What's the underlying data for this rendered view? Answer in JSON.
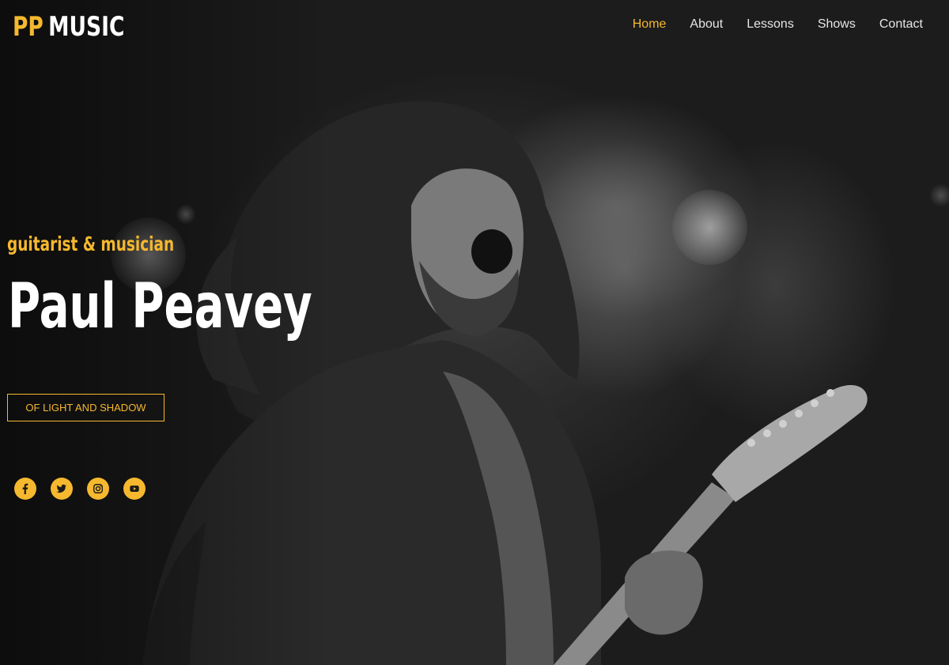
{
  "header": {
    "logo_pp": "PP",
    "logo_music": "MUSIC",
    "nav": [
      "Home",
      "About",
      "Lessons",
      "Shows",
      "Contact"
    ],
    "active_nav": "Home"
  },
  "hero": {
    "tagline": "guitarist & musician",
    "name": "Paul Peavey",
    "cta_label": "OF LIGHT AND SHADOW",
    "social_icons": [
      "facebook-icon",
      "twitter-icon",
      "instagram-icon",
      "youtube-icon"
    ]
  },
  "colors": {
    "accent": "#f5b82e",
    "text": "#ffffff",
    "background": "#1a1a1a"
  }
}
